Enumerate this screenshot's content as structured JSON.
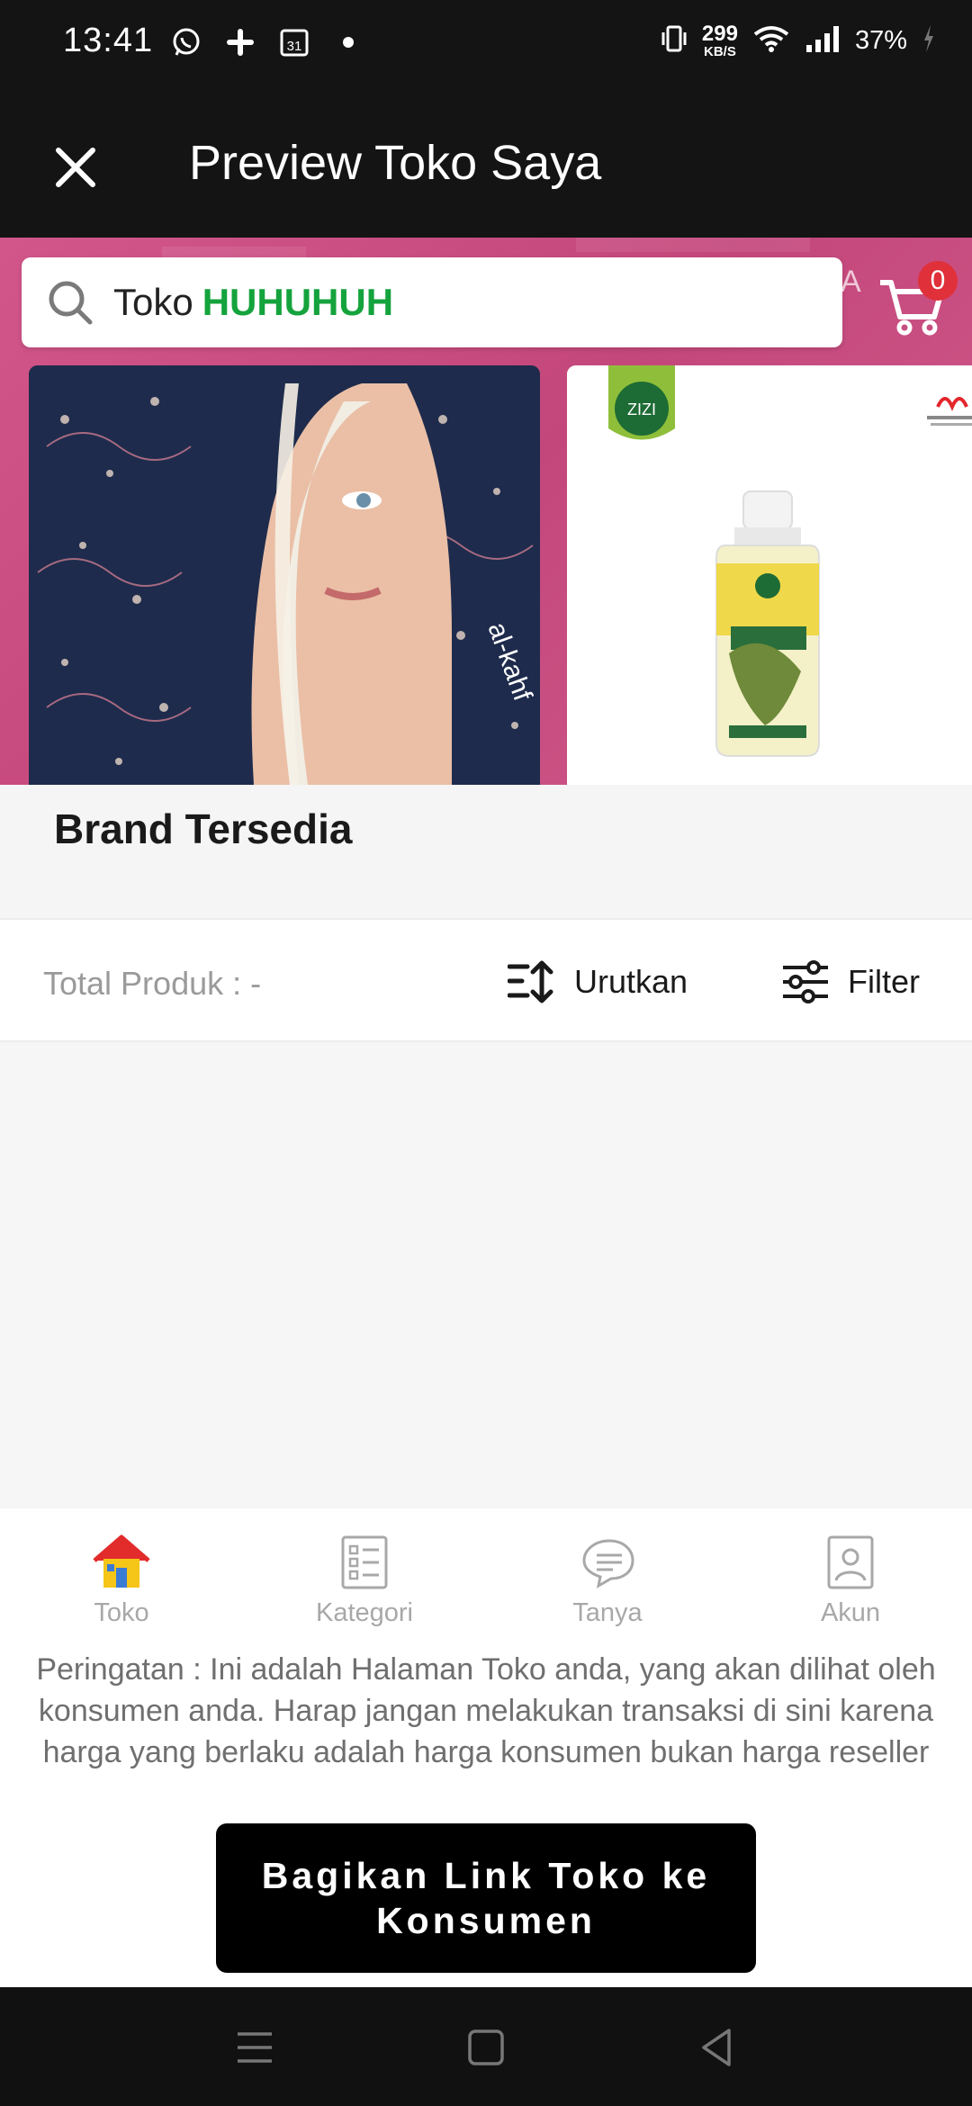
{
  "status_bar": {
    "time": "13:41",
    "left_icons": [
      "whatsapp-icon",
      "slack-icon",
      "calendar-icon",
      "dot-icon"
    ],
    "calendar_day": "31",
    "net_speed_value": "299",
    "net_speed_unit": "KB/S",
    "battery": "37%"
  },
  "app_bar": {
    "title": "Preview Toko Saya",
    "close_icon": "close-icon"
  },
  "search": {
    "prefix": "Toko",
    "store_name": "HUHUHUH",
    "store_name_color": "#14a33c"
  },
  "banner": {
    "partial_text": "A",
    "cart_count": "0",
    "product_brand": "ZIZI",
    "hijab_brand": "al-kahf"
  },
  "brand_section": {
    "title": "Brand Tersedia"
  },
  "toolbar": {
    "total_label": "Total Produk : -",
    "sort_label": "Urutkan",
    "filter_label": "Filter"
  },
  "bottom_nav": {
    "items": [
      {
        "label": "Toko",
        "icon": "store-icon",
        "active": true
      },
      {
        "label": "Kategori",
        "icon": "category-list-icon",
        "active": false
      },
      {
        "label": "Tanya",
        "icon": "chat-bubble-icon",
        "active": false
      },
      {
        "label": "Akun",
        "icon": "account-icon",
        "active": false
      }
    ]
  },
  "warning": {
    "text": "Peringatan : Ini adalah Halaman Toko anda, yang akan dilihat oleh konsumen anda. Harap jangan melakukan transaksi di sini karena harga yang berlaku adalah harga konsumen bukan harga reseller"
  },
  "share_button": {
    "label": "Bagikan Link Toko ke Konsumen"
  },
  "colors": {
    "app_bar": "#141414",
    "banner": "#c94b80",
    "accent_green": "#14a33c",
    "badge_red": "#e0303a"
  }
}
